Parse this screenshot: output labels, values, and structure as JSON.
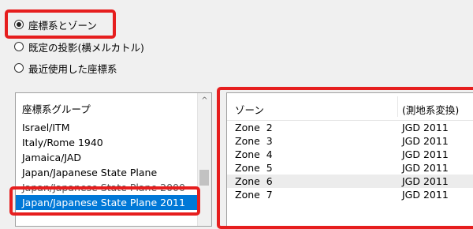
{
  "options": [
    {
      "label": "座標系とゾーン",
      "checked": true
    },
    {
      "label": "既定の投影(横メルカトル)",
      "checked": false
    },
    {
      "label": "最近使用した座標系",
      "checked": false
    }
  ],
  "group_list": {
    "header": "座標系グループ",
    "items": [
      "Israel/ITM",
      "Italy/Rome 1940",
      "Jamaica/JAD",
      "Japan/Japanese State Plane",
      "Japan/Japanese State Plane 2000",
      "Japan/Japanese State Plane 2011"
    ],
    "selected_index": 5
  },
  "zone_list": {
    "columns": [
      "ゾーン",
      "(測地系変換)"
    ],
    "rows": [
      [
        "Zone  2",
        "JGD 2011"
      ],
      [
        "Zone  3",
        "JGD 2011"
      ],
      [
        "Zone  4",
        "JGD 2011"
      ],
      [
        "Zone  5",
        "JGD 2011"
      ],
      [
        "Zone  6",
        "JGD 2011"
      ],
      [
        "Zone  7",
        "JGD 2011"
      ]
    ]
  },
  "colors": {
    "highlight": "#e61e1e",
    "selection": "#0078d7"
  }
}
